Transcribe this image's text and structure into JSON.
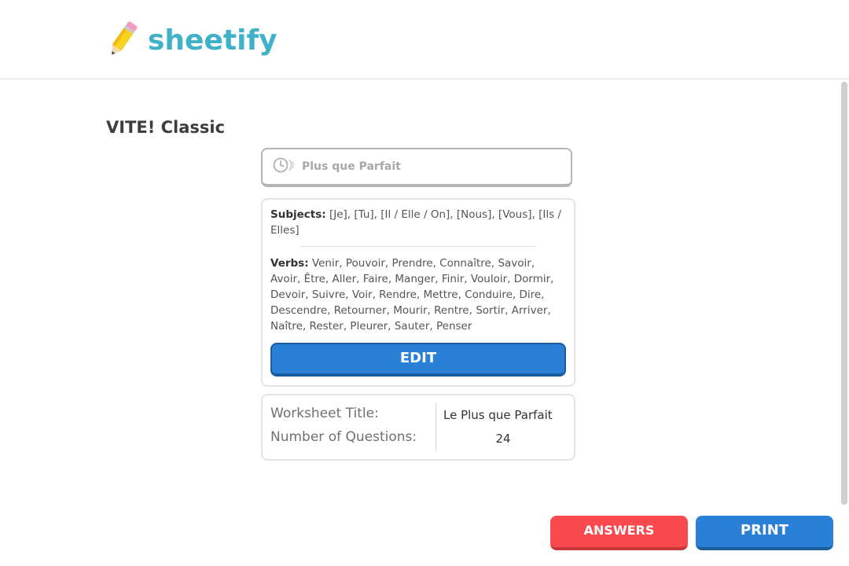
{
  "app": {
    "name": "sheetify",
    "logo_icon": "pencil-icon",
    "brand_color": "#3fb1c9"
  },
  "page": {
    "title": "VITE! Classic"
  },
  "tense": {
    "icon": "clock-icon",
    "label": "Plus que Parfait"
  },
  "details": {
    "subjects_label": "Subjects:",
    "subjects_value": " [Je], [Tu], [Il / Elle / On], [Nous], [Vous], [Ils / Elles]",
    "verbs_label": "Verbs:",
    "verbs_value": " Venir, Pouvoir, Prendre, Connaître, Savoir, Avoir, Être, Aller, Faire, Manger, Finir, Vouloir, Dormir, Devoir, Suivre, Voir, Rendre, Mettre, Conduire, Dire, Descendre, Retourner, Mourir, Rentre, Sortir, Arriver, Naître, Rester, Pleurer, Sauter, Penser",
    "edit_label": "EDIT"
  },
  "settings": {
    "title_label": "Worksheet Title:",
    "title_value": "Le Plus que Parfait",
    "questions_label": "Number of Questions:",
    "questions_value": "24"
  },
  "actions": {
    "answers_label": "ANSWERS",
    "print_label": "PRINT"
  },
  "colors": {
    "primary_blue": "#2a7fd6",
    "answers_red": "#f94a4f"
  }
}
